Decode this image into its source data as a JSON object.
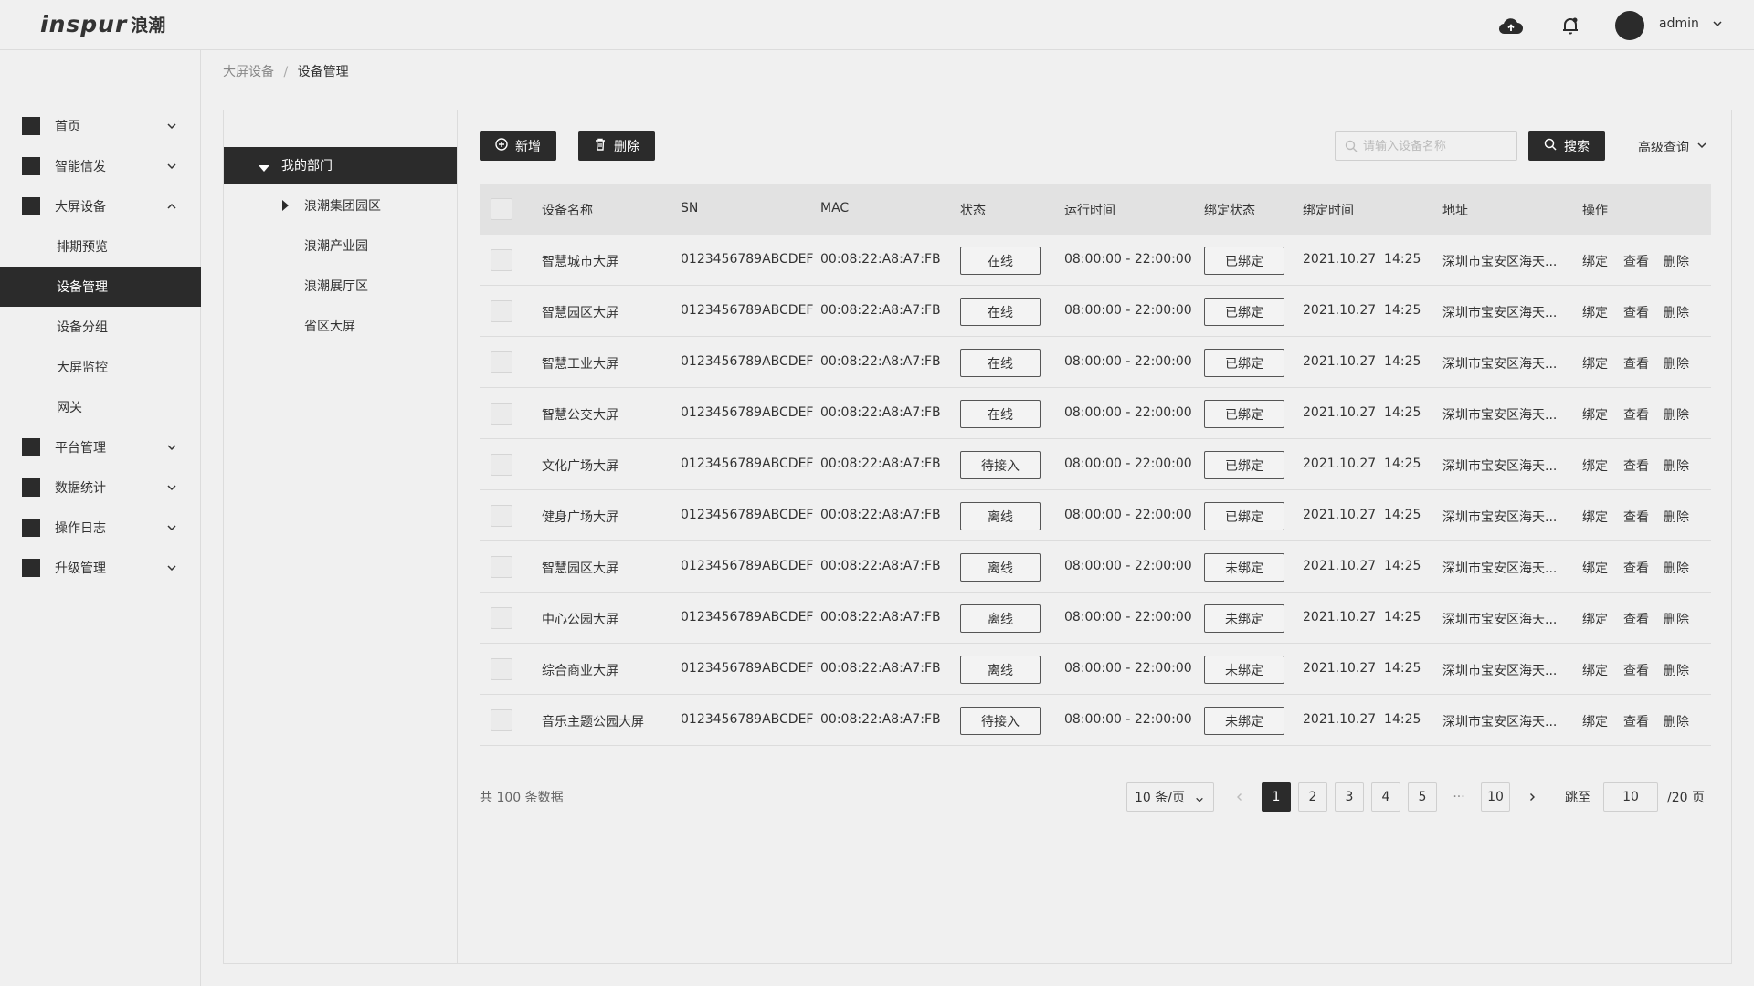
{
  "header": {
    "logo_latin": "inspur",
    "logo_cn": "浪潮",
    "user": "admin"
  },
  "sidebar": {
    "items": [
      {
        "label": "首页"
      },
      {
        "label": "智能信发"
      },
      {
        "label": "大屏设备"
      },
      {
        "label": "平台管理"
      },
      {
        "label": "数据统计"
      },
      {
        "label": "操作日志"
      },
      {
        "label": "升级管理"
      }
    ],
    "sub_items": [
      {
        "label": "排期预览"
      },
      {
        "label": "设备管理"
      },
      {
        "label": "设备分组"
      },
      {
        "label": "大屏监控"
      },
      {
        "label": "网关"
      }
    ],
    "active": "设备管理"
  },
  "breadcrumb": {
    "parent": "大屏设备",
    "separator": "/",
    "current": "设备管理"
  },
  "tree": {
    "root": "我的部门",
    "children": [
      "浪潮集团园区",
      "浪潮产业园",
      "浪潮展厅区",
      "省区大屏"
    ]
  },
  "toolbar": {
    "add_label": "新增",
    "delete_label": "删除",
    "search_placeholder": "请输入设备名称",
    "search_label": "搜索",
    "advanced_label": "高级查询"
  },
  "table": {
    "columns": [
      "设备名称",
      "SN",
      "MAC",
      "状态",
      "运行时间",
      "绑定状态",
      "绑定时间",
      "地址",
      "操作"
    ],
    "actions": [
      "绑定",
      "查看",
      "删除"
    ],
    "rows": [
      {
        "name": "智慧城市大屏",
        "sn": "0123456789ABCDEF",
        "mac": "00:08:22:A8:A7:FB",
        "status": "在线",
        "runtime": "08:00:00 - 22:00:00",
        "bind": "已绑定",
        "bind_time": "2021.10.27  14:25",
        "addr": "深圳市宝安区海天..."
      },
      {
        "name": "智慧园区大屏",
        "sn": "0123456789ABCDEF",
        "mac": "00:08:22:A8:A7:FB",
        "status": "在线",
        "runtime": "08:00:00 - 22:00:00",
        "bind": "已绑定",
        "bind_time": "2021.10.27  14:25",
        "addr": "深圳市宝安区海天..."
      },
      {
        "name": "智慧工业大屏",
        "sn": "0123456789ABCDEF",
        "mac": "00:08:22:A8:A7:FB",
        "status": "在线",
        "runtime": "08:00:00 - 22:00:00",
        "bind": "已绑定",
        "bind_time": "2021.10.27  14:25",
        "addr": "深圳市宝安区海天..."
      },
      {
        "name": "智慧公交大屏",
        "sn": "0123456789ABCDEF",
        "mac": "00:08:22:A8:A7:FB",
        "status": "在线",
        "runtime": "08:00:00 - 22:00:00",
        "bind": "已绑定",
        "bind_time": "2021.10.27  14:25",
        "addr": "深圳市宝安区海天..."
      },
      {
        "name": "文化广场大屏",
        "sn": "0123456789ABCDEF",
        "mac": "00:08:22:A8:A7:FB",
        "status": "待接入",
        "runtime": "08:00:00 - 22:00:00",
        "bind": "已绑定",
        "bind_time": "2021.10.27  14:25",
        "addr": "深圳市宝安区海天..."
      },
      {
        "name": "健身广场大屏",
        "sn": "0123456789ABCDEF",
        "mac": "00:08:22:A8:A7:FB",
        "status": "离线",
        "runtime": "08:00:00 - 22:00:00",
        "bind": "已绑定",
        "bind_time": "2021.10.27  14:25",
        "addr": "深圳市宝安区海天..."
      },
      {
        "name": "智慧园区大屏",
        "sn": "0123456789ABCDEF",
        "mac": "00:08:22:A8:A7:FB",
        "status": "离线",
        "runtime": "08:00:00 - 22:00:00",
        "bind": "未绑定",
        "bind_time": "2021.10.27  14:25",
        "addr": "深圳市宝安区海天..."
      },
      {
        "name": "中心公园大屏",
        "sn": "0123456789ABCDEF",
        "mac": "00:08:22:A8:A7:FB",
        "status": "离线",
        "runtime": "08:00:00 - 22:00:00",
        "bind": "未绑定",
        "bind_time": "2021.10.27  14:25",
        "addr": "深圳市宝安区海天..."
      },
      {
        "name": "综合商业大屏",
        "sn": "0123456789ABCDEF",
        "mac": "00:08:22:A8:A7:FB",
        "status": "离线",
        "runtime": "08:00:00 - 22:00:00",
        "bind": "未绑定",
        "bind_time": "2021.10.27  14:25",
        "addr": "深圳市宝安区海天..."
      },
      {
        "name": "音乐主题公园大屏",
        "sn": "0123456789ABCDEF",
        "mac": "00:08:22:A8:A7:FB",
        "status": "待接入",
        "runtime": "08:00:00 - 22:00:00",
        "bind": "未绑定",
        "bind_time": "2021.10.27  14:25",
        "addr": "深圳市宝安区海天..."
      }
    ]
  },
  "pagination": {
    "total_text": "共 100 条数据",
    "page_size": "10 条/页",
    "pages": [
      "1",
      "2",
      "3",
      "4",
      "5"
    ],
    "ellipsis": "···",
    "last_page": "10",
    "current": "1",
    "jump_label": "跳至",
    "jump_value": "10",
    "pages_total": "/20 页"
  },
  "colors": {
    "dark": "#2b2b2b",
    "background": "#f0f0f0",
    "header_row": "#e2e2e2"
  },
  "icons": [
    "cloud-upload-icon",
    "bell-icon",
    "chevron-down-icon",
    "plus-circle-icon",
    "trash-icon",
    "search-icon",
    "caret-right-icon",
    "caret-down-icon"
  ]
}
